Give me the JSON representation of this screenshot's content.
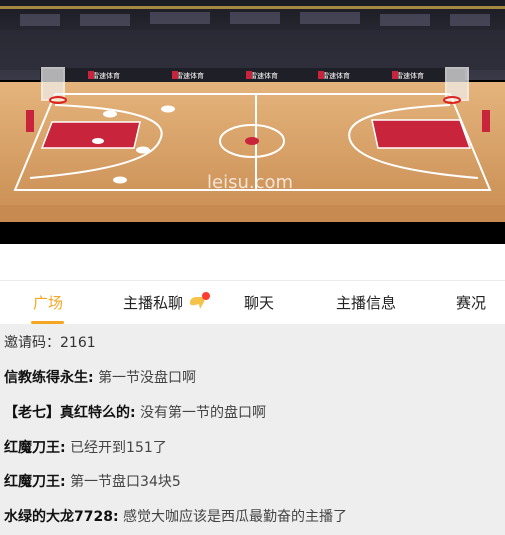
{
  "video": {
    "watermark": "leisu.com",
    "ad_board_text": "雷速体育"
  },
  "tabs": [
    {
      "label": "广场",
      "active": true
    },
    {
      "label": "主播私聊",
      "active": false,
      "badge_icon": "chat-bubble-icon"
    },
    {
      "label": "聊天",
      "active": false
    },
    {
      "label": "主播信息",
      "active": false
    },
    {
      "label": "赛况",
      "active": false
    }
  ],
  "chat": {
    "invite_code": "邀请码：2161",
    "messages": [
      {
        "user": "信教练得永生:",
        "text": "第一节没盘口啊"
      },
      {
        "user": "【老七】真红特么的:",
        "text": "没有第一节的盘口啊"
      },
      {
        "user": "红魔刀王:",
        "text": "已经开到151了"
      },
      {
        "user": "红魔刀王:",
        "text": "第一节盘口34块5"
      },
      {
        "user": "水绿的大龙7728:",
        "text": "感觉大咖应该是西瓜最勤奋的主播了"
      }
    ]
  },
  "colors": {
    "accent": "#f5a623",
    "chat_bg": "#eeeeee",
    "court_wood": "#d9a46a",
    "paint_red": "#c8243c"
  }
}
